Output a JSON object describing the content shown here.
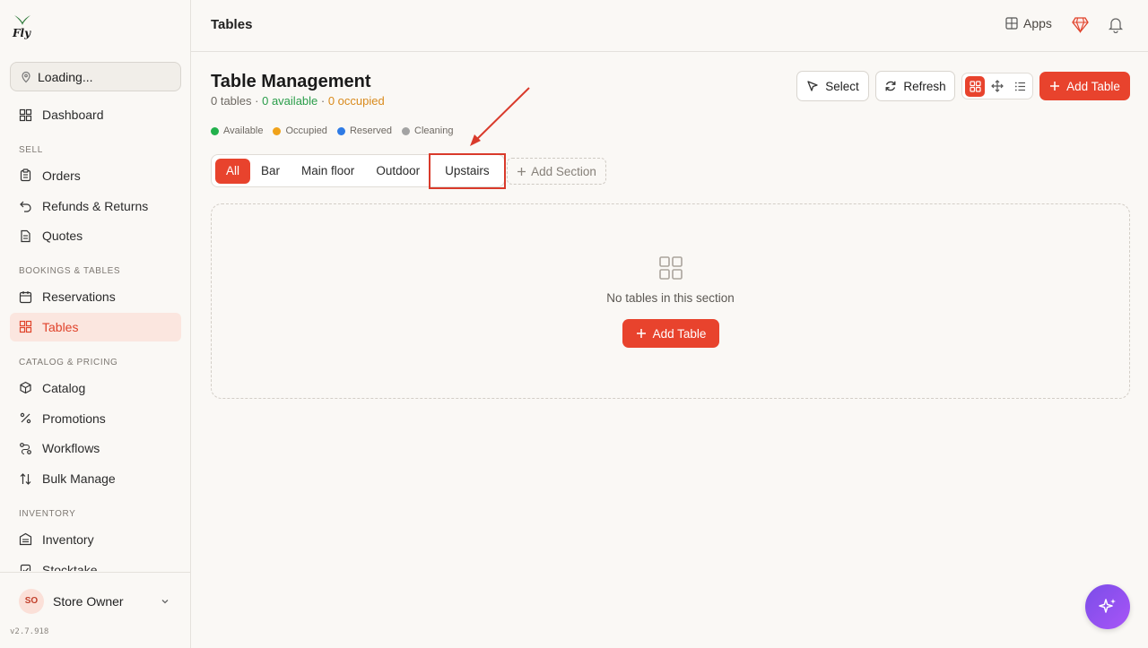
{
  "app": {
    "version": "v2.7.918"
  },
  "sidebar": {
    "location": "Loading...",
    "dashboard": "Dashboard",
    "sections": {
      "sell": "SELL",
      "bookings": "BOOKINGS & TABLES",
      "catalog": "CATALOG & PRICING",
      "inventory": "INVENTORY"
    },
    "items": {
      "orders": "Orders",
      "refunds": "Refunds & Returns",
      "quotes": "Quotes",
      "reservations": "Reservations",
      "tables": "Tables",
      "catalog": "Catalog",
      "promotions": "Promotions",
      "workflows": "Workflows",
      "bulk": "Bulk Manage",
      "inventory": "Inventory",
      "stocktake": "Stocktake"
    },
    "active": "Tables",
    "user": {
      "initials": "SO",
      "name": "Store Owner"
    }
  },
  "topbar": {
    "title": "Tables",
    "apps": "Apps"
  },
  "main": {
    "title": "Table Management",
    "counts": {
      "tables": "0 tables",
      "sep1": " · ",
      "available": "0 available",
      "sep2": " · ",
      "occupied": "0 occupied"
    },
    "legend": [
      {
        "label": "Available",
        "color": "#22b14c"
      },
      {
        "label": "Occupied",
        "color": "#f0a21a"
      },
      {
        "label": "Reserved",
        "color": "#2f7be5"
      },
      {
        "label": "Cleaning",
        "color": "#a3a3a3"
      }
    ],
    "tabs": [
      "All",
      "Bar",
      "Main floor",
      "Outdoor",
      "Upstairs"
    ],
    "active_tab": "All",
    "add_section": "Add Section",
    "buttons": {
      "select": "Select",
      "refresh": "Refresh",
      "add_table": "Add Table"
    },
    "empty": {
      "message": "No tables in this section",
      "add_table": "Add Table"
    }
  },
  "colors": {
    "accent": "#e8432d",
    "highlight": "#d93a2b",
    "fab": "#8b5cf6"
  }
}
